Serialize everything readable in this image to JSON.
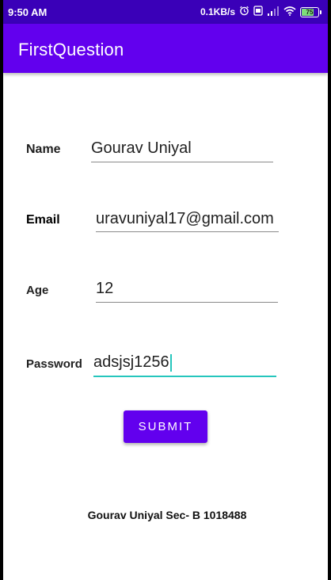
{
  "status_bar": {
    "time": "9:50 AM",
    "network_speed": "0.1KB/s",
    "battery_level": "75",
    "icons": [
      "alarm-icon",
      "sim-icon",
      "signal-icon",
      "wifi-icon",
      "battery-icon"
    ]
  },
  "app_bar": {
    "title": "FirstQuestion"
  },
  "form": {
    "name_label": "Name",
    "name_value": "Gourav Uniyal",
    "email_label": "Email",
    "email_value": "uravuniyal17@gmail.com",
    "age_label": "Age",
    "age_value": "12",
    "password_label": "Password",
    "password_value": "adsjsj1256",
    "submit_label": "SUBMIT"
  },
  "footer": {
    "text": "Gourav Uniyal Sec- B 1018488"
  },
  "colors": {
    "status_bar": "#3a00b8",
    "app_bar": "#6200ee",
    "accent": "#26c6bd",
    "button": "#6200ee"
  }
}
